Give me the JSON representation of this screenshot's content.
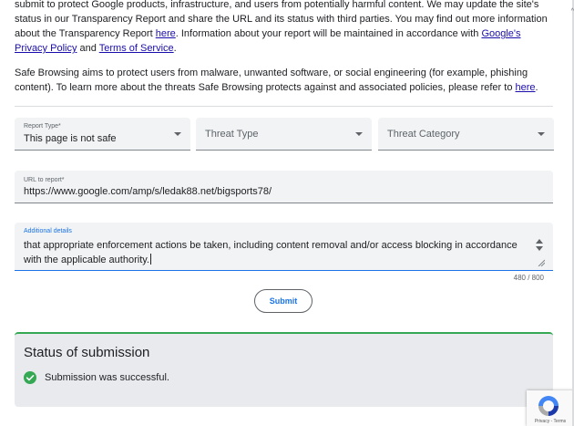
{
  "intro": {
    "p1_a": "submit to protect Google products, infrastructure, and users from potentially harmful content. We may update the site's status in our Transparency Report and share the URL and its status with third parties. You may update the site's status in our Transparency Report and share the URL and its status with third parties. You may find out more information about the Transparency Report ",
    "p1_text_a": "submit to protect Google products, infrastructure, and users from potentially harmful content. We may update the site's status in our Transparency Report and share the URL and its status with third parties. You may find out more information about the Transparency Report ",
    "p1_link_here": "here",
    "p1_text_b": ". Information about your report will be maintained in accordance with ",
    "p1_link_privacy": "Google's Privacy Policy",
    "p1_text_c": " and ",
    "p1_link_terms": "Terms of Service",
    "p1_text_d": ".",
    "p2_text_a": "Safe Browsing aims to protect users from malware, unwanted software, or social engineering (for example, phishing content). To learn more about the threats Safe Browsing protects against and associated policies, please refer to ",
    "p2_link_here": "here",
    "p2_text_b": "."
  },
  "form": {
    "report_type_label": "Report Type*",
    "report_type_value": "This page is not safe",
    "threat_type_placeholder": "Threat Type",
    "threat_category_placeholder": "Threat Category",
    "url_label": "URL to report*",
    "url_value": "https://www.google.com/amp/s/ledak88.net/bigsports78/",
    "details_label": "Additional details",
    "details_value": "that appropriate enforcement actions be taken, including content removal and/or access blocking in accordance with the applicable authority.",
    "char_count": "480 / 800",
    "submit_label": "Submit"
  },
  "status": {
    "title": "Status of submission",
    "message": "Submission was successful."
  },
  "recaptcha": {
    "links": "Privacy - Terms"
  },
  "colors": {
    "link": "#1a0dab",
    "accent": "#1a73e8",
    "success": "#34a853",
    "field_bg": "#f1f3f4"
  }
}
